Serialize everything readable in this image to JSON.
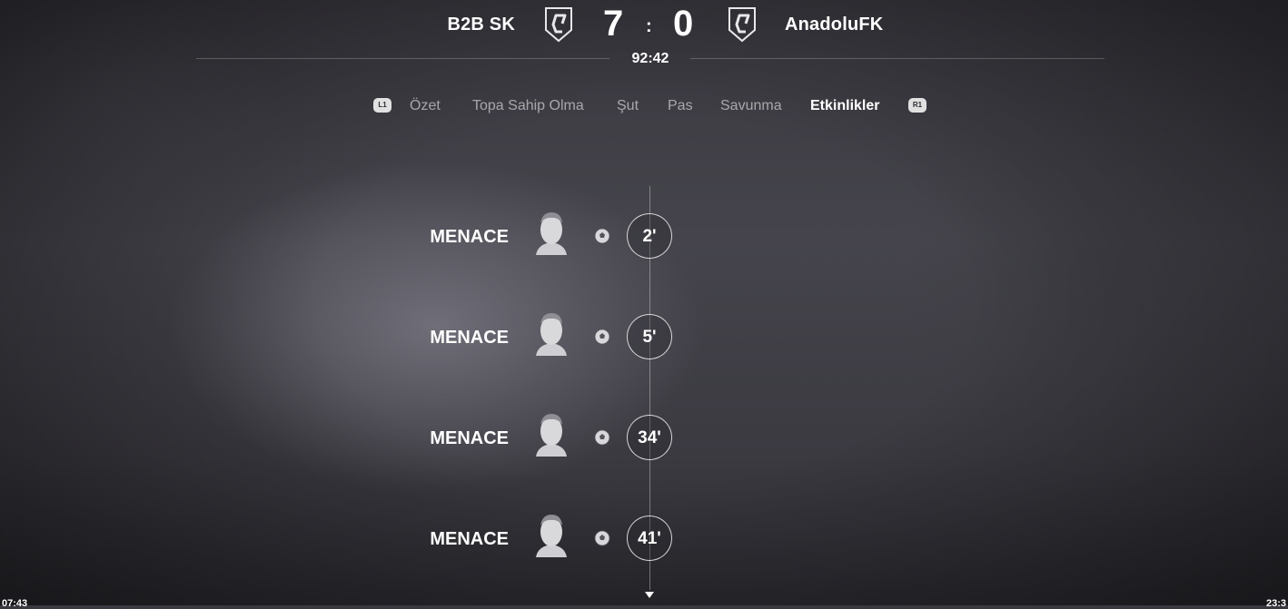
{
  "header": {
    "home_team": "B2B SK",
    "away_team": "AnadoluFK",
    "home_score": "7",
    "separator": ":",
    "away_score": "0",
    "clock": "92:42"
  },
  "tabs": {
    "left_hint": "L1",
    "right_hint": "R1",
    "items": [
      {
        "label": "Özet",
        "active": false
      },
      {
        "label": "Topa Sahip Olma",
        "active": false
      },
      {
        "label": "Şut",
        "active": false
      },
      {
        "label": "Pas",
        "active": false
      },
      {
        "label": "Savunma",
        "active": false
      },
      {
        "label": "Etkinlikler",
        "active": true
      }
    ]
  },
  "events": [
    {
      "player": "MENACE",
      "minute": "2'",
      "type": "goal",
      "icon": "football-icon"
    },
    {
      "player": "MENACE",
      "minute": "5'",
      "type": "goal",
      "icon": "football-icon"
    },
    {
      "player": "MENACE",
      "minute": "34'",
      "type": "goal",
      "icon": "football-icon"
    },
    {
      "player": "MENACE",
      "minute": "41'",
      "type": "goal",
      "icon": "football-icon"
    }
  ],
  "corners": {
    "left": "07:43",
    "right": "23:3"
  },
  "colors": {
    "text": "#ffffff",
    "muted_text": "#9a99a0",
    "background": "#3f3e45"
  }
}
